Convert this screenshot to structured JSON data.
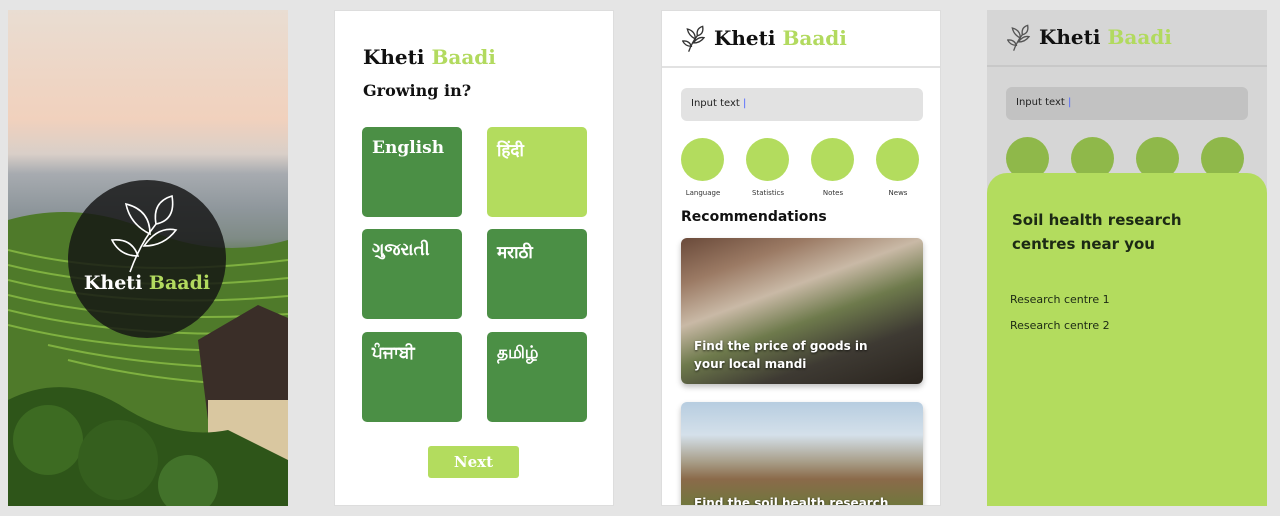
{
  "brand": {
    "name_part1": "Kheti",
    "name_part2": "Baadi"
  },
  "colors": {
    "dark_green": "#4b8f45",
    "light_green": "#b3dc5e",
    "muted_green": "#8fb84a"
  },
  "language_screen": {
    "subtitle": "Growing in?",
    "languages": [
      {
        "label": "English",
        "selected": false
      },
      {
        "label": "हिंदी",
        "selected": true
      },
      {
        "label": "ગુજરાતી",
        "selected": false
      },
      {
        "label": "मराठी",
        "selected": false
      },
      {
        "label": "ਪੰਜਾਬੀ",
        "selected": false
      },
      {
        "label": "தமிழ்",
        "selected": false
      }
    ],
    "next_label": "Next"
  },
  "home_screen": {
    "search_placeholder": "Input text",
    "quick_actions": [
      {
        "label": "Language",
        "icon": "language-icon"
      },
      {
        "label": "Statistics",
        "icon": "statistics-icon"
      },
      {
        "label": "Notes",
        "icon": "notes-icon"
      },
      {
        "label": "News",
        "icon": "news-icon"
      }
    ],
    "recommendations_title": "Recommendations",
    "recommendations": [
      {
        "text": "Find the price of goods in your local mandi"
      },
      {
        "text": "Find the soil health research"
      }
    ]
  },
  "research_screen": {
    "search_placeholder": "Input text",
    "title": "Soil health research centres near you",
    "centres": [
      "Research centre 1",
      "Research centre 2"
    ]
  }
}
